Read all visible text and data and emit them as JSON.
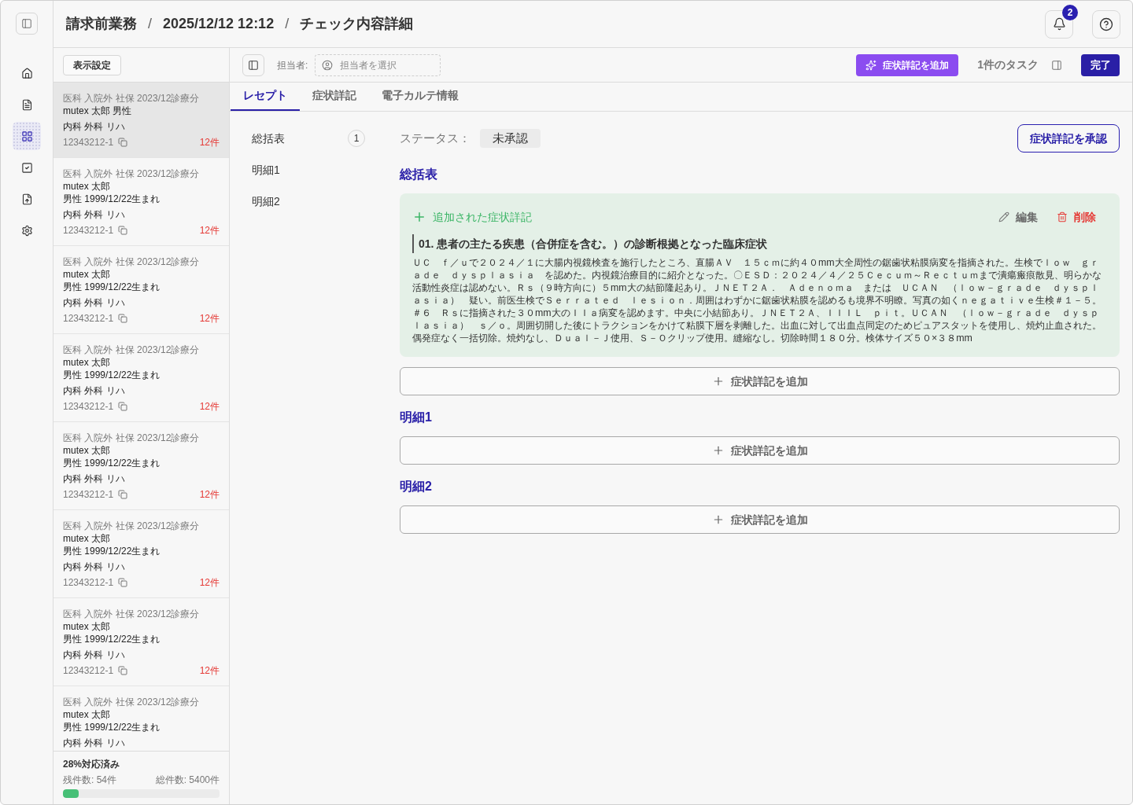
{
  "rail": {
    "items": [
      {
        "kind": "home",
        "selected": false
      },
      {
        "kind": "document",
        "selected": false
      },
      {
        "kind": "grid",
        "selected": true
      },
      {
        "kind": "check",
        "selected": false
      },
      {
        "kind": "upload",
        "selected": false
      },
      {
        "kind": "settings",
        "selected": false
      }
    ]
  },
  "header": {
    "breadcrumb": [
      {
        "kind": "crumb",
        "text": "請求前業務"
      },
      {
        "kind": "separator",
        "text": "/"
      },
      {
        "kind": "crumb",
        "text": "2025/12/12 12:12"
      },
      {
        "kind": "separator",
        "text": "/"
      },
      {
        "kind": "crumb",
        "text": "チェック内容詳細"
      }
    ],
    "notification_count": "2"
  },
  "list_panel": {
    "settings_button": "表示設定",
    "items": [
      {
        "category": "医科 入院外 社保 2023/12診療分",
        "patient": "mutex 太郎 男性",
        "departments": "内科 外科 リハ",
        "id": "12343212-1",
        "count": "12件",
        "selected": true
      },
      {
        "category": "医科 入院外 社保 2023/12診療分",
        "patient": "mutex 太郎",
        "details": "男性 1999/12/22生まれ",
        "departments": "内科 外科 リハ",
        "id": "12343212-1",
        "count": "12件",
        "selected": false
      },
      {
        "category": "医科 入院外 社保 2023/12診療分",
        "patient": "mutex 太郎",
        "details": "男性 1999/12/22生まれ",
        "departments": "内科 外科 リハ",
        "id": "12343212-1",
        "count": "12件",
        "selected": false
      },
      {
        "category": "医科 入院外 社保 2023/12診療分",
        "patient": "mutex 太郎",
        "details": "男性 1999/12/22生まれ",
        "departments": "内科 外科 リハ",
        "id": "12343212-1",
        "count": "12件",
        "selected": false
      },
      {
        "category": "医科 入院外 社保 2023/12診療分",
        "patient": "mutex 太郎",
        "details": "男性 1999/12/22生まれ",
        "departments": "内科 外科 リハ",
        "id": "12343212-1",
        "count": "12件",
        "selected": false
      },
      {
        "category": "医科 入院外 社保 2023/12診療分",
        "patient": "mutex 太郎",
        "details": "男性 1999/12/22生まれ",
        "departments": "内科 外科 リハ",
        "id": "12343212-1",
        "count": "12件",
        "selected": false
      },
      {
        "category": "医科 入院外 社保 2023/12診療分",
        "patient": "mutex 太郎",
        "details": "男性 1999/12/22生まれ",
        "departments": "内科 外科 リハ",
        "id": "12343212-1",
        "count": "12件",
        "selected": false
      },
      {
        "category": "医科 入院外 社保 2023/12診療分",
        "patient": "mutex 太郎",
        "details": "男性 1999/12/22生まれ",
        "departments": "内科 外科 リハ",
        "selected": false
      }
    ],
    "progress": {
      "title": "28%対応済み",
      "remaining": "残件数: 54件",
      "total": "総件数: 5400件",
      "level": 0.1
    }
  },
  "toolbar": {
    "assignee_label": "担当者:",
    "assignee_placeholder": "担当者を選択",
    "ai_button": "症状詳記を追加",
    "tasks": "1件のタスク",
    "done_button": "完了"
  },
  "tabs": [
    {
      "label": "レセプト",
      "selected": true
    },
    {
      "label": "症状詳記",
      "selected": false
    },
    {
      "label": "電子カルテ情報",
      "selected": false
    }
  ],
  "subnav": [
    {
      "label": "総括表",
      "count": "1"
    },
    {
      "label": "明細1"
    },
    {
      "label": "明細2"
    }
  ],
  "status": {
    "label": "ステータス：",
    "value": "未承認"
  },
  "approve_button": "症状詳記を承認",
  "sections": [
    {
      "title": "総括表",
      "entries": [
        {
          "status": "追加された症状詳記",
          "edit": "編集",
          "delete": "削除",
          "title": "01. 患者の主たる疾患（合併症を含む。）の診断根拠となった臨床症状",
          "body": "ＵＣ　ｆ／ｕで２０２４／１に大腸内視鏡検査を施行したところ、直腸ＡＶ　１５ｃｍに約４０mm大全周性の鋸歯状粘膜病変を指摘された。生検でｌｏｗ　ｇｒａｄｅ　ｄｙｓｐｌａｓｉａ　を認めた。内視鏡治療目的に紹介となった。〇ＥＳＤ：２０２４／４／２５Ｃｅｃｕｍ～Ｒｅｃｔｕｍまで潰瘍瘢痕散見、明らかな活動性炎症は認めない。Ｒｓ（９時方向に）５mm大の結節隆起あり。ＪＮＥＴ２Ａ．　Ａｄｅｎｏｍａ　または　ＵＣＡＮ　（ｌｏｗ－ｇｒａｄｅ　ｄｙｓｐｌａｓｉａ）　疑い。前医生検でＳｅｒｒａｔｅｄ　ｌｅｓｉｏｎ．周囲はわずかに鋸歯状粘膜を認めるも境界不明瞭。写真の如くｎｅｇａｔｉｖｅ生検＃１－５。＃６　Ｒｓに指摘された３０mm大のＩＩａ病変を認めます。中央に小結節あり。ＪＮＥＴ２Ａ、ＩＩＩＬ　ｐｉｔ。ＵＣＡＮ　（ｌｏｗ－ｇｒａｄｅ　ｄｙｓｐｌａｓｉａ）　ｓ／ｏ。周囲切開した後にトラクションをかけて粘膜下層を剥離した。出血に対して出血点同定のためピュアスタットを使用し、焼灼止血された。偶発症なく一括切除。焼灼なし、Ｄｕａｌ－Ｊ使用、Ｓ－Ｏクリップ使用。縫縮なし。切除時間１８０分。検体サイズ５０×３８mm"
        }
      ],
      "add_button": "症状詳記を追加"
    },
    {
      "title": "明細1",
      "add_button": "症状詳記を追加"
    },
    {
      "title": "明細2",
      "add_button": "症状詳記を追加"
    }
  ]
}
